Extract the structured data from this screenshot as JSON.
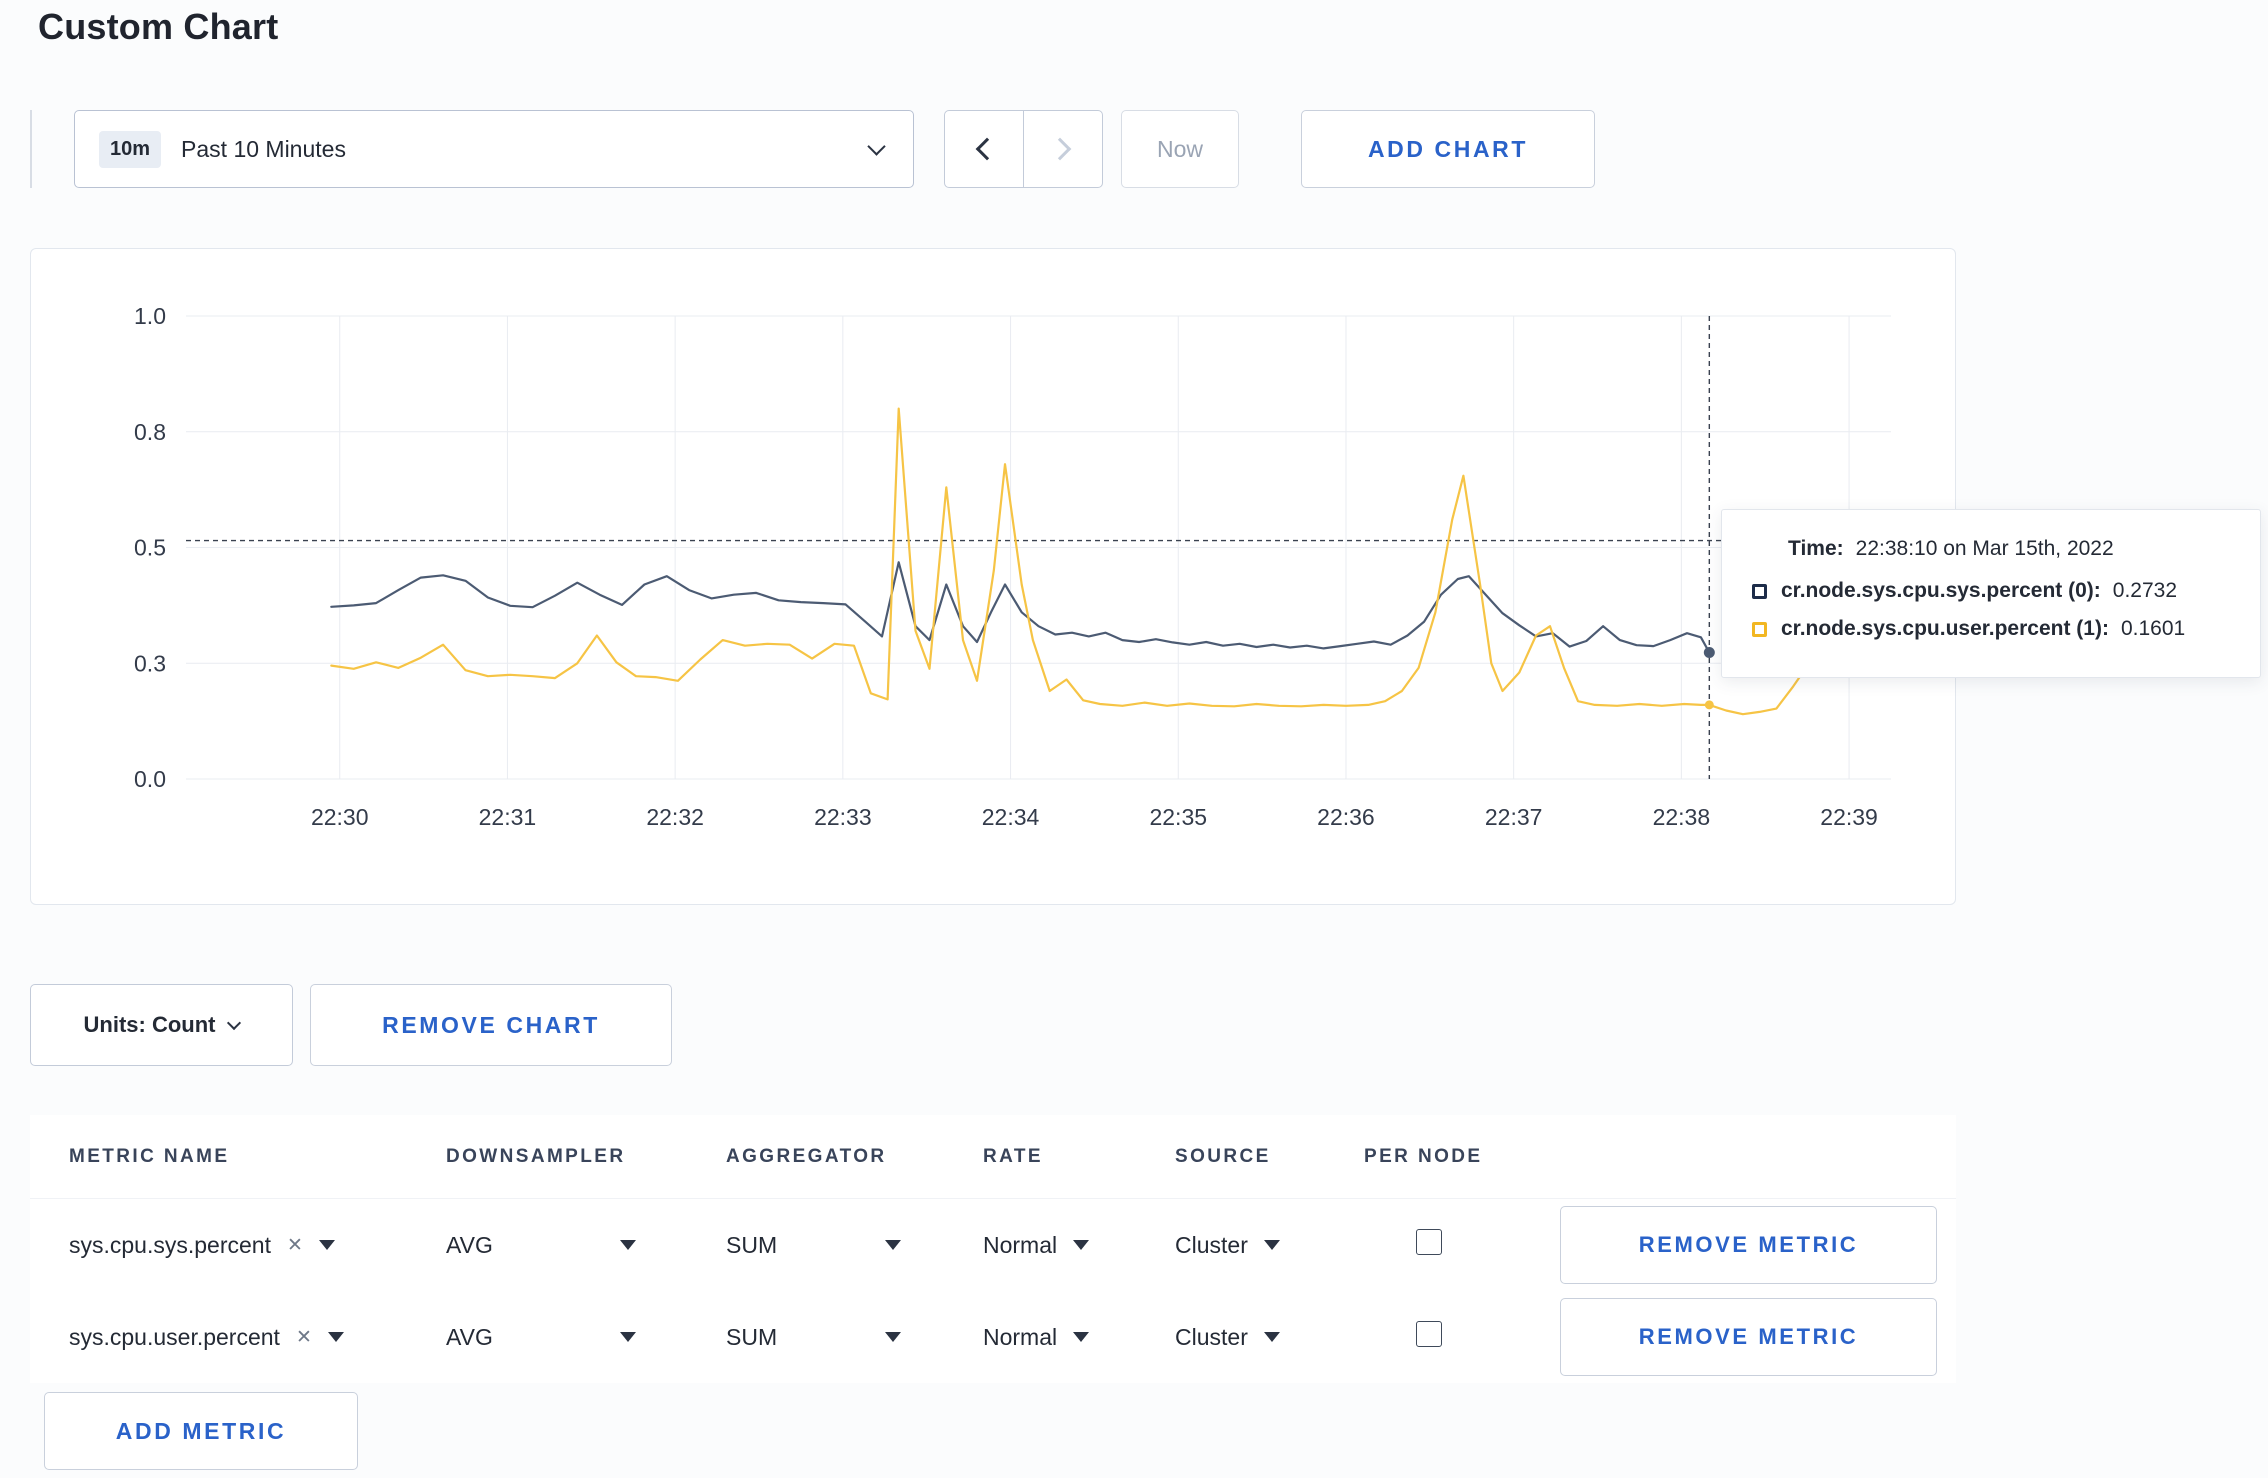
{
  "page": {
    "title": "Custom Chart"
  },
  "colors": {
    "accent_blue": "#2a62c9",
    "series_sys": "#4c5b73",
    "series_user": "#f6c445",
    "swatch_sys": "#1d2c49",
    "swatch_user": "#f2b722"
  },
  "toolbar": {
    "time_badge": "10m",
    "time_label": "Past 10 Minutes",
    "now_label": "Now",
    "add_chart_label": "ADD CHART"
  },
  "tooltip": {
    "time_label": "Time:",
    "time_value": "22:38:10 on Mar 15th, 2022",
    "series": [
      {
        "name": "cr.node.sys.cpu.sys.percent (0):",
        "value": "0.2732",
        "swatch_color": "#1d2c49"
      },
      {
        "name": "cr.node.sys.cpu.user.percent (1):",
        "value": "0.1601",
        "swatch_color": "#f2b722"
      }
    ]
  },
  "chart_data": {
    "type": "line",
    "title": "",
    "xlabel": "",
    "ylabel": "",
    "x_unit": "seconds after 22:29:00",
    "x_domain": [
      5,
      615
    ],
    "y_domain": [
      0,
      1
    ],
    "grid": true,
    "grid_color": "#e9ecf1",
    "crosshair_color": "#3a4250",
    "x_ticks": [
      {
        "t": 60,
        "label": "22:30"
      },
      {
        "t": 120,
        "label": "22:31"
      },
      {
        "t": 180,
        "label": "22:32"
      },
      {
        "t": 240,
        "label": "22:33"
      },
      {
        "t": 300,
        "label": "22:34"
      },
      {
        "t": 360,
        "label": "22:35"
      },
      {
        "t": 420,
        "label": "22:36"
      },
      {
        "t": 480,
        "label": "22:37"
      },
      {
        "t": 540,
        "label": "22:38"
      },
      {
        "t": 600,
        "label": "22:39"
      }
    ],
    "y_ticks": [
      {
        "v": 0,
        "label": "0.0"
      },
      {
        "v": 0.25,
        "label": "0.3"
      },
      {
        "v": 0.5,
        "label": "0.5"
      },
      {
        "v": 0.75,
        "label": "0.8"
      },
      {
        "v": 1,
        "label": "1.0"
      }
    ],
    "crosshair": {
      "t": 550,
      "time": "22:38:10",
      "threshold_line_v": 0.515,
      "hover_points": [
        {
          "series": 0,
          "v": 0.2732
        },
        {
          "series": 1,
          "v": 0.1601
        }
      ]
    },
    "series": [
      {
        "name": "cr.node.sys.cpu.sys.percent",
        "color": "#4c5b73",
        "points": [
          [
            57,
            0.372
          ],
          [
            65,
            0.375
          ],
          [
            73,
            0.38
          ],
          [
            81,
            0.408
          ],
          [
            89,
            0.435
          ],
          [
            97,
            0.44
          ],
          [
            105,
            0.428
          ],
          [
            113,
            0.392
          ],
          [
            121,
            0.374
          ],
          [
            129,
            0.371
          ],
          [
            137,
            0.396
          ],
          [
            145,
            0.424
          ],
          [
            153,
            0.398
          ],
          [
            161,
            0.376
          ],
          [
            169,
            0.42
          ],
          [
            177,
            0.438
          ],
          [
            185,
            0.408
          ],
          [
            193,
            0.39
          ],
          [
            201,
            0.398
          ],
          [
            209,
            0.402
          ],
          [
            217,
            0.386
          ],
          [
            225,
            0.382
          ],
          [
            233,
            0.38
          ],
          [
            241,
            0.377
          ],
          [
            248,
            0.34
          ],
          [
            254,
            0.308
          ],
          [
            260,
            0.468
          ],
          [
            266,
            0.33
          ],
          [
            271,
            0.3
          ],
          [
            277,
            0.42
          ],
          [
            283,
            0.33
          ],
          [
            288,
            0.296
          ],
          [
            293,
            0.36
          ],
          [
            298,
            0.42
          ],
          [
            304,
            0.36
          ],
          [
            310,
            0.33
          ],
          [
            316,
            0.312
          ],
          [
            322,
            0.316
          ],
          [
            328,
            0.308
          ],
          [
            334,
            0.316
          ],
          [
            340,
            0.3
          ],
          [
            346,
            0.296
          ],
          [
            352,
            0.302
          ],
          [
            358,
            0.295
          ],
          [
            364,
            0.29
          ],
          [
            370,
            0.296
          ],
          [
            376,
            0.288
          ],
          [
            382,
            0.292
          ],
          [
            388,
            0.285
          ],
          [
            394,
            0.29
          ],
          [
            400,
            0.284
          ],
          [
            406,
            0.288
          ],
          [
            412,
            0.282
          ],
          [
            418,
            0.287
          ],
          [
            424,
            0.292
          ],
          [
            430,
            0.297
          ],
          [
            436,
            0.29
          ],
          [
            442,
            0.31
          ],
          [
            448,
            0.34
          ],
          [
            454,
            0.398
          ],
          [
            460,
            0.432
          ],
          [
            464,
            0.438
          ],
          [
            470,
            0.398
          ],
          [
            476,
            0.358
          ],
          [
            482,
            0.332
          ],
          [
            488,
            0.308
          ],
          [
            494,
            0.315
          ],
          [
            500,
            0.286
          ],
          [
            506,
            0.298
          ],
          [
            512,
            0.33
          ],
          [
            518,
            0.3
          ],
          [
            524,
            0.289
          ],
          [
            530,
            0.287
          ],
          [
            536,
            0.3
          ],
          [
            542,
            0.315
          ],
          [
            547,
            0.306
          ],
          [
            550,
            0.2732
          ]
        ]
      },
      {
        "name": "cr.node.sys.cpu.user.percent",
        "color": "#f6c445",
        "points": [
          [
            57,
            0.245
          ],
          [
            65,
            0.238
          ],
          [
            73,
            0.252
          ],
          [
            81,
            0.24
          ],
          [
            89,
            0.262
          ],
          [
            97,
            0.29
          ],
          [
            105,
            0.235
          ],
          [
            113,
            0.222
          ],
          [
            121,
            0.225
          ],
          [
            129,
            0.222
          ],
          [
            137,
            0.218
          ],
          [
            145,
            0.25
          ],
          [
            152,
            0.31
          ],
          [
            159,
            0.252
          ],
          [
            166,
            0.222
          ],
          [
            173,
            0.22
          ],
          [
            181,
            0.212
          ],
          [
            189,
            0.258
          ],
          [
            197,
            0.3
          ],
          [
            205,
            0.288
          ],
          [
            213,
            0.292
          ],
          [
            221,
            0.29
          ],
          [
            229,
            0.26
          ],
          [
            237,
            0.292
          ],
          [
            244,
            0.288
          ],
          [
            250,
            0.185
          ],
          [
            256,
            0.172
          ],
          [
            260,
            0.8
          ],
          [
            266,
            0.32
          ],
          [
            271,
            0.238
          ],
          [
            277,
            0.63
          ],
          [
            283,
            0.3
          ],
          [
            288,
            0.212
          ],
          [
            294,
            0.45
          ],
          [
            298,
            0.68
          ],
          [
            304,
            0.42
          ],
          [
            308,
            0.3
          ],
          [
            314,
            0.19
          ],
          [
            320,
            0.215
          ],
          [
            326,
            0.17
          ],
          [
            332,
            0.162
          ],
          [
            340,
            0.158
          ],
          [
            348,
            0.165
          ],
          [
            356,
            0.158
          ],
          [
            364,
            0.163
          ],
          [
            372,
            0.158
          ],
          [
            380,
            0.157
          ],
          [
            388,
            0.162
          ],
          [
            396,
            0.158
          ],
          [
            404,
            0.157
          ],
          [
            412,
            0.16
          ],
          [
            420,
            0.158
          ],
          [
            428,
            0.16
          ],
          [
            434,
            0.168
          ],
          [
            440,
            0.19
          ],
          [
            446,
            0.24
          ],
          [
            452,
            0.36
          ],
          [
            458,
            0.56
          ],
          [
            462,
            0.655
          ],
          [
            468,
            0.42
          ],
          [
            472,
            0.25
          ],
          [
            476,
            0.19
          ],
          [
            482,
            0.23
          ],
          [
            488,
            0.31
          ],
          [
            493,
            0.33
          ],
          [
            498,
            0.24
          ],
          [
            503,
            0.168
          ],
          [
            509,
            0.16
          ],
          [
            517,
            0.158
          ],
          [
            525,
            0.162
          ],
          [
            533,
            0.158
          ],
          [
            541,
            0.162
          ],
          [
            547,
            0.16
          ],
          [
            550,
            0.1601
          ],
          [
            556,
            0.148
          ],
          [
            562,
            0.14
          ],
          [
            568,
            0.145
          ],
          [
            574,
            0.152
          ],
          [
            580,
            0.2
          ],
          [
            586,
            0.252
          ],
          [
            592,
            0.275
          ],
          [
            597,
            0.272
          ],
          [
            600,
            0.252
          ]
        ]
      }
    ]
  },
  "units_row": {
    "units_label": "Units: Count",
    "remove_chart_label": "REMOVE CHART"
  },
  "metrics_table": {
    "headers": [
      "METRIC NAME",
      "DOWNSAMPLER",
      "AGGREGATOR",
      "RATE",
      "SOURCE",
      "PER NODE"
    ],
    "rows": [
      {
        "metric": "sys.cpu.sys.percent",
        "downsampler": "AVG",
        "aggregator": "SUM",
        "rate": "Normal",
        "source": "Cluster",
        "per_node": false,
        "remove_label": "REMOVE METRIC"
      },
      {
        "metric": "sys.cpu.user.percent",
        "downsampler": "AVG",
        "aggregator": "SUM",
        "rate": "Normal",
        "source": "Cluster",
        "per_node": false,
        "remove_label": "REMOVE METRIC"
      }
    ],
    "add_metric_label": "ADD METRIC"
  }
}
